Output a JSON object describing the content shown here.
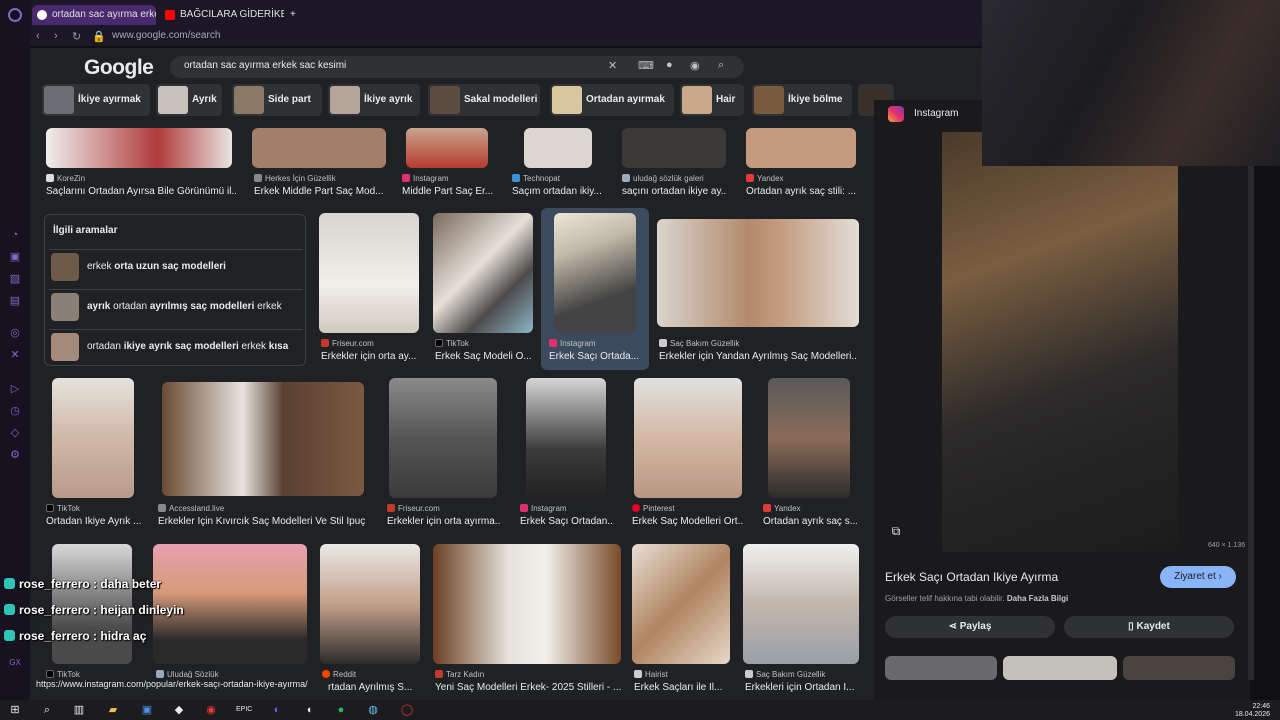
{
  "browser": {
    "tabs": [
      {
        "label": "ortadan sac ayırma erkek s"
      },
      {
        "label": "BAĞCILARA GİDERİKEN"
      }
    ],
    "new_tab": "+",
    "url": "www.google.com/search"
  },
  "google": {
    "logo": "Google",
    "query": "ortadan sac ayırma erkek sac kesimi",
    "chips": [
      "İkiye ayırmak",
      "Ayrık",
      "Side part",
      "İkiye ayrık",
      "Sakal modelleri",
      "Ortadan ayırmak",
      "Hair",
      "İkiye bölme"
    ]
  },
  "row1": [
    {
      "source": "KoreZin",
      "title": "Saçlarını Ortadan Ayırsa Bile Görünümü il..."
    },
    {
      "source": "Herkes İçin Güzellik",
      "title": "Erkek Middle Part Saç Mod..."
    },
    {
      "source": "Instagram",
      "title": "Middle Part Saç Er..."
    },
    {
      "source": "Technopat",
      "title": "Saçım ortadan ikiy..."
    },
    {
      "source": "uludağ sözlük galeri",
      "title": "saçını ortadan ikiye ay..."
    },
    {
      "source": "Yandex",
      "title": "Ortadan ayrık saç stili: ..."
    }
  ],
  "related": {
    "heading": "İlgili aramalar",
    "items": [
      {
        "pre": "erkek ",
        "bold": "orta uzun saç modelleri",
        "post": ""
      },
      {
        "pre": "",
        "bold": "ayrık",
        "post": " ortadan ",
        "bold2": "ayrılmış saç modelleri",
        "post2": " erkek"
      },
      {
        "pre": "ortadan ",
        "bold": "ikiye ayrık saç modelleri",
        "post": " erkek ",
        "bold2": "kısa",
        "post2": ""
      }
    ]
  },
  "row2": [
    {
      "source": "Friseur.com",
      "title": "Erkekler için orta ay..."
    },
    {
      "source": "TikTok",
      "title": "Erkek Saç Modeli O..."
    },
    {
      "source": "Instagram",
      "title": "Erkek Saçı Ortada..."
    },
    {
      "source": "Saç Bakım Güzellik",
      "title": "Erkekler için Yandan Ayrılmış Saç Modelleri..."
    }
  ],
  "row3": [
    {
      "source": "TikTok",
      "title": "Ortadan İkiye Ayrık ..."
    },
    {
      "source": "Accessland.live",
      "title": "Erkekler İçin Kıvırcık Saç Modelleri Ve Stil İpuç..."
    },
    {
      "source": "Friseur.com",
      "title": "Erkekler için orta ayırma..."
    },
    {
      "source": "Instagram",
      "title": "Erkek Saçı Ortadan..."
    },
    {
      "source": "Pinterest",
      "title": "Erkek Saç Modelleri Ort..."
    },
    {
      "source": "Yandex",
      "title": "Ortadan ayrık saç s..."
    }
  ],
  "row4": [
    {
      "source": "TikTok",
      "title": ""
    },
    {
      "source": "Uludağ Sözlük",
      "title": ""
    },
    {
      "source": "Reddit",
      "title": "rtadan Ayrılmış S..."
    },
    {
      "source": "Tarz Kadın",
      "title": "Yeni Saç Modelleri Erkek- 2025 Stilleri - ..."
    },
    {
      "source": "Hairist",
      "title": "Erkek Saçları ile İl..."
    },
    {
      "source": "Saç Bakım Güzellik",
      "title": "Erkekleri için Ortadan İ..."
    }
  ],
  "panel": {
    "source": "Instagram",
    "dimensions": "640 × 1.136",
    "title": "Erkek Saçı Ortadan Ikiye Ayırma",
    "visit": "Ziyaret et",
    "notice": "Görseller telif hakkına tabi olabilir.",
    "notice_link": "Daha Fazla Bilgi",
    "share": "Paylaş",
    "save": "Kaydet"
  },
  "chat": [
    {
      "user": "rose_ferrero",
      "msg": " : daha beter"
    },
    {
      "user": "rose_ferrero",
      "msg": " : heijan dinleyin"
    },
    {
      "user": "rose_ferrero",
      "msg": " : hidra aç"
    }
  ],
  "status_url": "https://www.instagram.com/popular/erkek-saçı-ortadan-ikiye-ayırma/",
  "clock": {
    "time": "22:46",
    "date": "18.04.2026"
  }
}
